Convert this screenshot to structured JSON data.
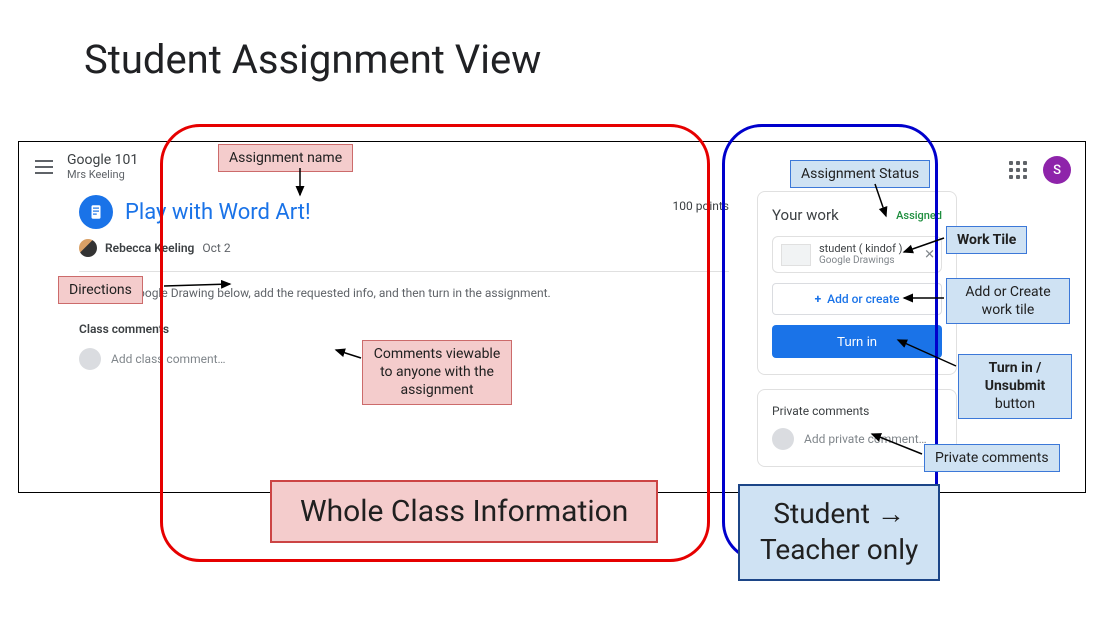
{
  "slide": {
    "title": "Student Assignment View"
  },
  "header": {
    "class_name": "Google 101",
    "teacher_line": "Mrs Keeling",
    "avatar_initial": "S"
  },
  "assignment": {
    "title": "Play with Word Art!",
    "points": "100 points",
    "author": "Rebecca Keeling",
    "date": "Oct 2",
    "directions": "Open the Google Drawing below, add the requested info, and then turn in the assignment."
  },
  "class_comments": {
    "section_label": "Class comments",
    "placeholder": "Add class comment…"
  },
  "your_work": {
    "title": "Your work",
    "status": "Assigned",
    "tile_name": "student ( kindof ) …",
    "tile_sub": "Google Drawings",
    "add_create_label": "Add or create",
    "turn_in_label": "Turn in"
  },
  "private_comments": {
    "section_label": "Private comments",
    "placeholder": "Add private comment…"
  },
  "annotations": {
    "assignment_name": "Assignment name",
    "directions": "Directions",
    "comments_public": "Comments viewable to anyone with the assignment",
    "assignment_status": "Assignment Status",
    "work_tile": "Work Tile",
    "add_or_create": "Add or Create work tile",
    "turn_in_btn": "Turn in / Unsubmit button",
    "private_comments": "Private comments",
    "whole_class": "Whole Class Information",
    "student_teacher": "Student → Teacher only"
  }
}
